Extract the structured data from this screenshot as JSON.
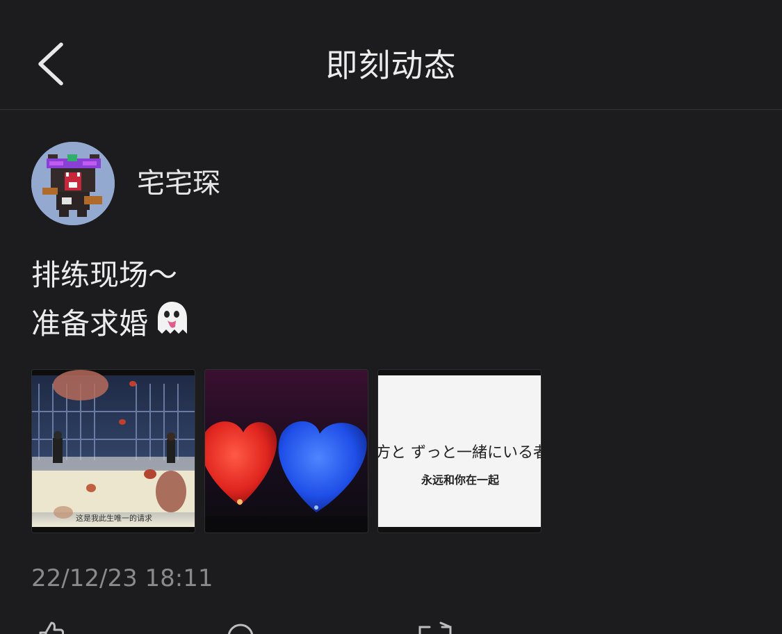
{
  "header": {
    "title": "即刻动态",
    "back_icon": "chevron-left-icon"
  },
  "post": {
    "author": {
      "name": "宅宅琛",
      "avatar_icon": "pixel-bear-avatar"
    },
    "text_lines": [
      "排练现场～",
      "准备求婚"
    ],
    "emoji": "ghost-emoji",
    "images": [
      {
        "kind": "anime-still",
        "caption": "这是我此生唯一的请求"
      },
      {
        "kind": "heart-balloons-photo",
        "balloon_colors": [
          "#e0251f",
          "#1f4fe8"
        ]
      },
      {
        "kind": "text-slide",
        "jp_text": "方と ずっと一緒にいる者",
        "cn_text": "永远和你在一起"
      }
    ],
    "timestamp": "22/12/23 18:11"
  },
  "actions": [
    {
      "name": "like",
      "icon": "thumbs-up-icon"
    },
    {
      "name": "comment",
      "icon": "comment-bubble-icon"
    },
    {
      "name": "share",
      "icon": "share-icon"
    }
  ],
  "colors": {
    "background": "#1c1c1e",
    "text_primary": "#ececec",
    "text_secondary": "#8a8a8e",
    "divider": "#333336"
  }
}
